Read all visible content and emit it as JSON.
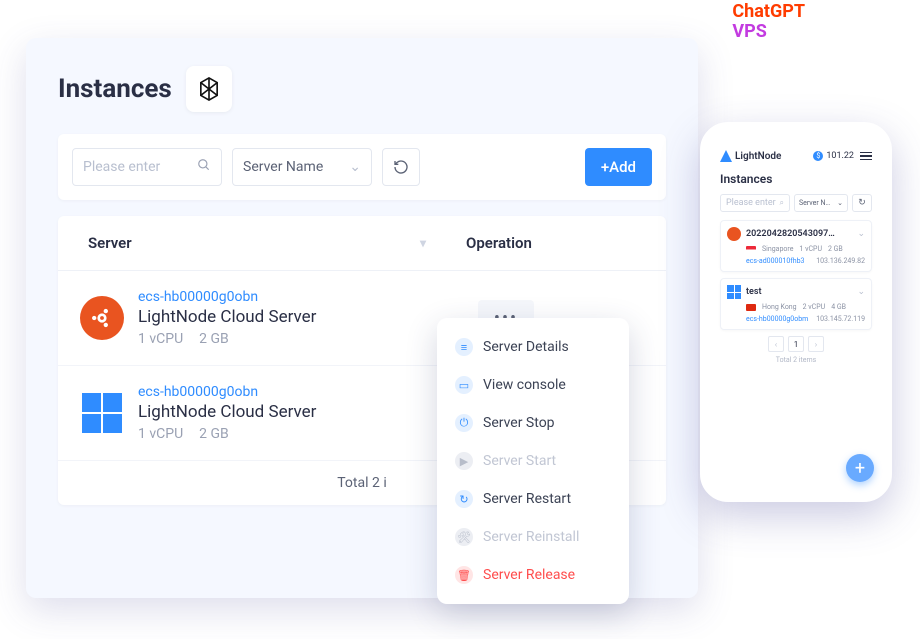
{
  "watermark": {
    "line1": "ChatGPT",
    "line2": "VPS"
  },
  "panel": {
    "title": "Instances",
    "search_placeholder": "Please enter",
    "select_label": "Server Name",
    "add_label": "+Add",
    "columns": {
      "server": "Server",
      "operation": "Operation"
    },
    "footer": "Total 2 i"
  },
  "rows": [
    {
      "os": "ubuntu",
      "id": "ecs-hb00000g0obn",
      "name": "LightNode Cloud Server",
      "cpu": "1 vCPU",
      "ram": "2 GB"
    },
    {
      "os": "windows",
      "id": "ecs-hb00000g0obn",
      "name": "LightNode Cloud Server",
      "cpu": "1 vCPU",
      "ram": "2 GB"
    }
  ],
  "menu": {
    "details": "Server Details",
    "console": "View console",
    "stop": "Server Stop",
    "start": "Server Start",
    "restart": "Server Restart",
    "reinstall": "Server Reinstall",
    "release": "Server Release"
  },
  "phone": {
    "brand": "LightNode",
    "balance": "101.22",
    "title": "Instances",
    "search_placeholder": "Please enter",
    "select_label": "Server N…",
    "cards": [
      {
        "os": "ubuntu",
        "name": "2022042820543097…",
        "region": "Singapore",
        "flag": "sg",
        "cpu": "1 vCPU",
        "ram": "2 GB",
        "id": "ecs-ad000010fhb3",
        "ip": "103.136.249.82"
      },
      {
        "os": "windows",
        "name": "test",
        "region": "Hong Kong",
        "flag": "hk",
        "cpu": "2 vCPU",
        "ram": "4 GB",
        "id": "ecs-hb00000g0obm",
        "ip": "103.145.72.119"
      }
    ],
    "page": "1",
    "total": "Total 2 items"
  }
}
